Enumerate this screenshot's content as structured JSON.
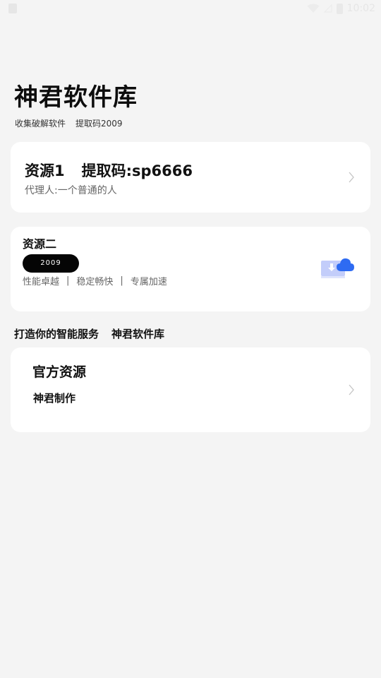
{
  "status_bar": {
    "time": "10:02"
  },
  "header": {
    "title": "神君软件库",
    "subtitle_left": "收集破解软件",
    "subtitle_right": "提取码2009"
  },
  "card1": {
    "resource_label": "资源1",
    "code_label": "提取码:sp6666",
    "agent_text": "代理人:一个普通的人"
  },
  "card2": {
    "title": "资源二",
    "pill_text": "2009",
    "features": [
      "性能卓越",
      "稳定畅快",
      "专属加速"
    ],
    "separator": "|"
  },
  "section": {
    "left": "打造你的智能服务",
    "right": "神君软件库"
  },
  "card3": {
    "title": "官方资源",
    "subtitle": "神君制作"
  },
  "colors": {
    "background": "#f4f4f4",
    "card": "#ffffff",
    "cloud_blue": "#2e6bf2",
    "tray_blue": "#c3cdfa"
  }
}
